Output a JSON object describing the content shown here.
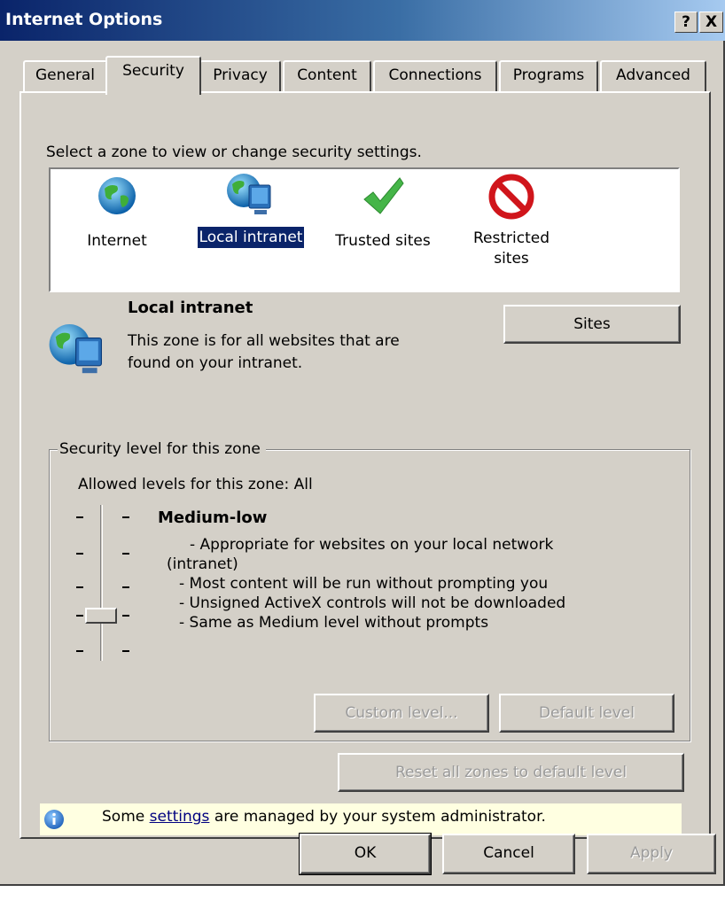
{
  "window": {
    "title": "Internet Options",
    "help_button": "?",
    "close_button": "X"
  },
  "tabs": [
    {
      "label": "General",
      "active": false
    },
    {
      "label": "Security",
      "active": true
    },
    {
      "label": "Privacy",
      "active": false
    },
    {
      "label": "Content",
      "active": false
    },
    {
      "label": "Connections",
      "active": false
    },
    {
      "label": "Programs",
      "active": false
    },
    {
      "label": "Advanced",
      "active": false
    }
  ],
  "zones": {
    "prompt": "Select a zone to view or change security settings.",
    "items": [
      {
        "label": "Internet",
        "icon": "globe-icon",
        "selected": false
      },
      {
        "label": "Local intranet",
        "icon": "globe-computer-icon",
        "selected": true
      },
      {
        "label": "Trusted sites",
        "icon": "checkmark-icon",
        "selected": false
      },
      {
        "label_line1": "Restricted",
        "label_line2": "sites",
        "icon": "no-entry-icon",
        "selected": false
      }
    ]
  },
  "zone_info": {
    "title": "Local intranet",
    "description_line1": "This zone is for all websites that are",
    "description_line2": "found on your intranet.",
    "sites_button": "Sites"
  },
  "security_level": {
    "group_title": "Security level for this zone",
    "allowed": "Allowed levels for this zone: All",
    "level_name": "Medium-low",
    "level_value": 2,
    "level_count": 5,
    "bullets": [
      "- Appropriate for websites on your local network",
      "(intranet)",
      "- Most content will be run without prompting you",
      "- Unsigned ActiveX controls will not be downloaded",
      "- Same as Medium level without prompts"
    ],
    "custom_button": "Custom level...",
    "default_button": "Default level"
  },
  "reset_button": "Reset all zones to default level",
  "info_bar": {
    "text_before": "Some ",
    "link": "settings",
    "text_after": " are managed by your system administrator."
  },
  "footer": {
    "ok": "OK",
    "cancel": "Cancel",
    "apply": "Apply"
  },
  "colors": {
    "title_bar": "#0a246a",
    "face": "#d4d0c8",
    "selection": "#0a246a",
    "info_bar": "#ffffe1"
  }
}
